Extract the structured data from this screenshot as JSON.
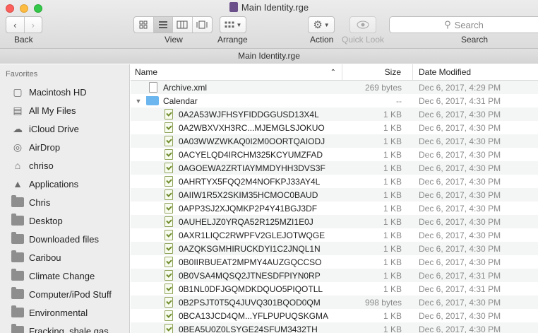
{
  "window": {
    "title": "Main Identity.rge"
  },
  "toolbar": {
    "back_label": "Back",
    "view_label": "View",
    "arrange_label": "Arrange",
    "action_label": "Action",
    "quicklook_label": "Quick Look",
    "search_label": "Search",
    "search_placeholder": "Search"
  },
  "path_bar": {
    "title": "Main Identity.rge"
  },
  "sidebar": {
    "heading": "Favorites",
    "items": [
      {
        "label": "Macintosh HD",
        "icon": "hard-drive-icon"
      },
      {
        "label": "All My Files",
        "icon": "all-files-icon"
      },
      {
        "label": "iCloud Drive",
        "icon": "cloud-icon"
      },
      {
        "label": "AirDrop",
        "icon": "airdrop-icon"
      },
      {
        "label": "chriso",
        "icon": "home-icon"
      },
      {
        "label": "Applications",
        "icon": "applications-icon"
      },
      {
        "label": "Chris",
        "icon": "folder-icon"
      },
      {
        "label": "Desktop",
        "icon": "folder-icon"
      },
      {
        "label": "Downloaded files",
        "icon": "folder-icon"
      },
      {
        "label": "Caribou",
        "icon": "folder-icon"
      },
      {
        "label": "Climate Change",
        "icon": "folder-icon"
      },
      {
        "label": "Computer/iPod Stuff",
        "icon": "folder-icon"
      },
      {
        "label": "Environmental",
        "icon": "folder-icon"
      },
      {
        "label": "Fracking, shale gas...",
        "icon": "folder-icon"
      }
    ]
  },
  "columns": {
    "name": "Name",
    "size": "Size",
    "date": "Date Modified"
  },
  "rows": [
    {
      "name": "Archive.xml",
      "size": "269 bytes",
      "date": "Dec 6, 2017, 4:29 PM",
      "kind": "file",
      "indent": 0
    },
    {
      "name": "Calendar",
      "size": "--",
      "date": "Dec 6, 2017, 4:31 PM",
      "kind": "folder",
      "indent": 0
    },
    {
      "name": "0A2A53WJFHSYFIDDGGUSD13X4L",
      "size": "1 KB",
      "date": "Dec 6, 2017, 4:30 PM",
      "kind": "vcf",
      "indent": 1
    },
    {
      "name": "0A2WBXVXH3RC...MJEMGLSJOKUO",
      "size": "1 KB",
      "date": "Dec 6, 2017, 4:30 PM",
      "kind": "vcf",
      "indent": 1
    },
    {
      "name": "0A03WWZWKAQ0I2M0OORTQAIODJ",
      "size": "1 KB",
      "date": "Dec 6, 2017, 4:30 PM",
      "kind": "vcf",
      "indent": 1
    },
    {
      "name": "0ACYELQD4IRCHM325KCYUMZFAD",
      "size": "1 KB",
      "date": "Dec 6, 2017, 4:30 PM",
      "kind": "vcf",
      "indent": 1
    },
    {
      "name": "0AGOEWA2ZRTIAYMMDYHH3DVS3F",
      "size": "1 KB",
      "date": "Dec 6, 2017, 4:30 PM",
      "kind": "vcf",
      "indent": 1
    },
    {
      "name": "0AHRTYX5FQQ2M4NOFKPJ33AY4L",
      "size": "1 KB",
      "date": "Dec 6, 2017, 4:30 PM",
      "kind": "vcf",
      "indent": 1
    },
    {
      "name": "0AIIW1R5X2SKIM35HCMOC0BAUD",
      "size": "1 KB",
      "date": "Dec 6, 2017, 4:30 PM",
      "kind": "vcf",
      "indent": 1
    },
    {
      "name": "0APP3SJ2XJQMKP2P4Y41BGJ3DF",
      "size": "1 KB",
      "date": "Dec 6, 2017, 4:30 PM",
      "kind": "vcf",
      "indent": 1
    },
    {
      "name": "0AUHELJZ0YRQA52R125MZI1E0J",
      "size": "1 KB",
      "date": "Dec 6, 2017, 4:30 PM",
      "kind": "vcf",
      "indent": 1
    },
    {
      "name": "0AXR1LIQC2RWPFV2GLEJOTWQGE",
      "size": "1 KB",
      "date": "Dec 6, 2017, 4:30 PM",
      "kind": "vcf",
      "indent": 1
    },
    {
      "name": "0AZQKSGMHIRUCKDYI1C2JNQL1N",
      "size": "1 KB",
      "date": "Dec 6, 2017, 4:30 PM",
      "kind": "vcf",
      "indent": 1
    },
    {
      "name": "0B0IIRBUEAT2MPMY4AUZGQCCSO",
      "size": "1 KB",
      "date": "Dec 6, 2017, 4:30 PM",
      "kind": "vcf",
      "indent": 1
    },
    {
      "name": "0B0VSA4MQSQ2JTNESDFPIYN0RP",
      "size": "1 KB",
      "date": "Dec 6, 2017, 4:31 PM",
      "kind": "vcf",
      "indent": 1
    },
    {
      "name": "0B1NL0DFJGQMDKDQUO5PIQOTLL",
      "size": "1 KB",
      "date": "Dec 6, 2017, 4:31 PM",
      "kind": "vcf",
      "indent": 1
    },
    {
      "name": "0B2PSJT0T5Q4JUVQ301BQOD0QM",
      "size": "998 bytes",
      "date": "Dec 6, 2017, 4:30 PM",
      "kind": "vcf",
      "indent": 1
    },
    {
      "name": "0BCA13JCD4QM...YFLPUPUQSKGMA",
      "size": "1 KB",
      "date": "Dec 6, 2017, 4:30 PM",
      "kind": "vcf",
      "indent": 1
    },
    {
      "name": "0BEA5U0Z0LSYGE24SFUM3432TH",
      "size": "1 KB",
      "date": "Dec 6, 2017, 4:30 PM",
      "kind": "vcf",
      "indent": 1
    }
  ]
}
